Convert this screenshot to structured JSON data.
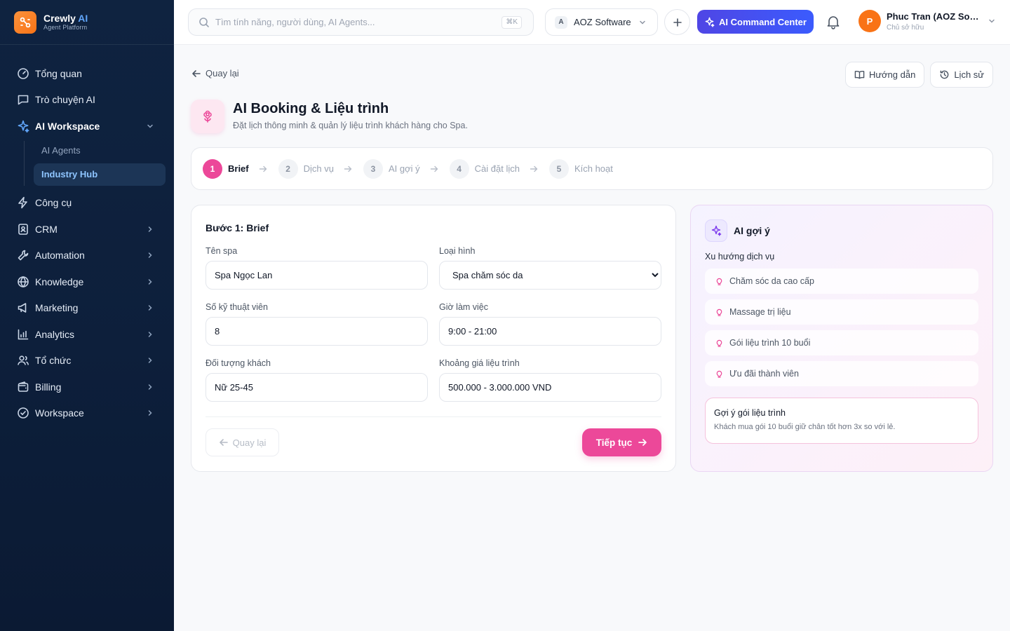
{
  "brand": {
    "name": "Crewly",
    "name_accent": "AI",
    "subtitle": "Agent Platform"
  },
  "sidebar": {
    "items": [
      {
        "label": "Tổng quan",
        "icon": "dashboard-icon"
      },
      {
        "label": "Trò chuyện AI",
        "icon": "chat-icon"
      },
      {
        "label": "AI Workspace",
        "icon": "sparkle-icon",
        "expanded": true
      },
      {
        "label": "Công cụ",
        "icon": "lightning-icon"
      },
      {
        "label": "CRM",
        "icon": "contacts-icon"
      },
      {
        "label": "Automation",
        "icon": "wrench-icon"
      },
      {
        "label": "Knowledge",
        "icon": "globe-icon"
      },
      {
        "label": "Marketing",
        "icon": "megaphone-icon"
      },
      {
        "label": "Analytics",
        "icon": "bar-chart-icon"
      },
      {
        "label": "Tổ chức",
        "icon": "users-icon"
      },
      {
        "label": "Billing",
        "icon": "wallet-icon"
      },
      {
        "label": "Workspace",
        "icon": "check-circle-icon"
      }
    ],
    "sub_items": [
      {
        "label": "AI Agents",
        "active": false
      },
      {
        "label": "Industry Hub",
        "active": true
      }
    ]
  },
  "topbar": {
    "search_placeholder": "Tìm tính năng, người dùng, AI Agents...",
    "search_value": "",
    "shortcut": "⌘K",
    "org_badge": "A",
    "org_name": "AOZ Software",
    "command_label": "AI Command Center",
    "user_initial": "P",
    "user_name": "Phuc Tran (AOZ Software)",
    "user_role": "Chủ sở hữu"
  },
  "page": {
    "back_label": "Quay lại",
    "guide_label": "Hướng dẫn",
    "history_label": "Lịch sử",
    "title": "AI Booking & Liệu trình",
    "subtitle": "Đặt lịch thông minh & quản lý liệu trình khách hàng cho Spa."
  },
  "steps": [
    {
      "num": "1",
      "label": "Brief",
      "active": true
    },
    {
      "num": "2",
      "label": "Dịch vụ",
      "active": false
    },
    {
      "num": "3",
      "label": "AI gợi ý",
      "active": false
    },
    {
      "num": "4",
      "label": "Cài đặt lịch",
      "active": false
    },
    {
      "num": "5",
      "label": "Kích hoạt",
      "active": false
    }
  ],
  "form": {
    "title": "Bước 1: Brief",
    "spa_name": {
      "label": "Tên spa",
      "value": "Spa Ngọc Lan"
    },
    "spa_type": {
      "label": "Loại hình",
      "value": "Spa chăm sóc da"
    },
    "technicians": {
      "label": "Số kỹ thuật viên",
      "value": "8"
    },
    "hours": {
      "label": "Giờ làm việc",
      "value": "9:00 - 21:00"
    },
    "audience": {
      "label": "Đối tượng khách",
      "value": "Nữ 25-45"
    },
    "price_range": {
      "label": "Khoảng giá liệu trình",
      "value": "500.000 - 3.000.000 VND"
    },
    "prev_label": "Quay lại",
    "next_label": "Tiếp tục"
  },
  "ai_panel": {
    "title": "AI gợi ý",
    "trend_label": "Xu hướng dịch vụ",
    "trends": [
      "Chăm sóc da cao cấp",
      "Massage trị liệu",
      "Gói liệu trình 10 buổi",
      "Ưu đãi thành viên"
    ],
    "tip_title": "Gợi ý gói liệu trình",
    "tip_text": "Khách mua gói 10 buổi giữ chân tốt hơn 3x so với lẻ."
  },
  "colors": {
    "accent": "#ec4899",
    "primary": "#4f46e5",
    "sidebar_bg": "#0f2340"
  }
}
